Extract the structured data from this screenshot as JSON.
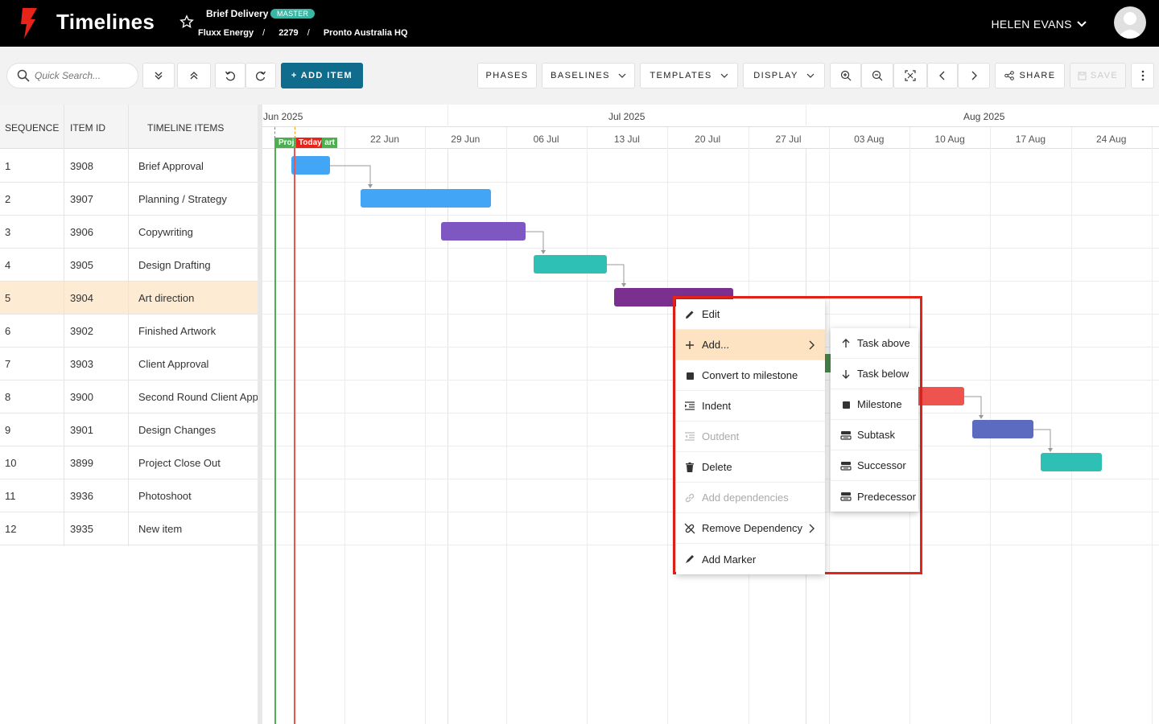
{
  "app": {
    "title": "Timelines"
  },
  "project": {
    "name": "Brief Delivery",
    "badge": "MASTER",
    "client": "Fluxx Energy",
    "job_number": "2279",
    "office": "Pronto Australia HQ"
  },
  "user": {
    "name": "HELEN EVANS"
  },
  "toolbar": {
    "search_placeholder": "Quick Search...",
    "add_item": "+ ADD ITEM",
    "phases": "PHASES",
    "baselines": "BASELINES",
    "templates": "TEMPLATES",
    "display": "DISPLAY",
    "share": "SHARE",
    "save": "SAVE"
  },
  "grid": {
    "headers": {
      "sequence": "SEQUENCE",
      "item_id": "ITEM ID",
      "items": "TIMELINE ITEMS"
    },
    "rows": [
      {
        "seq": "1",
        "id": "3908",
        "name": "Brief Approval"
      },
      {
        "seq": "2",
        "id": "3907",
        "name": "Planning / Strategy"
      },
      {
        "seq": "3",
        "id": "3906",
        "name": "Copywriting"
      },
      {
        "seq": "4",
        "id": "3905",
        "name": "Design Drafting"
      },
      {
        "seq": "5",
        "id": "3904",
        "name": "Art direction"
      },
      {
        "seq": "6",
        "id": "3902",
        "name": "Finished Artwork"
      },
      {
        "seq": "7",
        "id": "3903",
        "name": "Client Approval"
      },
      {
        "seq": "8",
        "id": "3900",
        "name": "Second Round Client Approval"
      },
      {
        "seq": "9",
        "id": "3901",
        "name": "Design Changes"
      },
      {
        "seq": "10",
        "id": "3899",
        "name": "Project Close Out"
      },
      {
        "seq": "11",
        "id": "3936",
        "name": "Photoshoot"
      },
      {
        "seq": "12",
        "id": "3935",
        "name": "New item"
      }
    ]
  },
  "gantt": {
    "months": [
      "Jun 2025",
      "Jul 2025",
      "Aug 2025"
    ],
    "weeks": [
      "22 Jun",
      "29 Jun",
      "06 Jul",
      "13 Jul",
      "20 Jul",
      "27 Jul",
      "03 Aug",
      "10 Aug",
      "17 Aug",
      "24 Aug"
    ],
    "markers": {
      "project_start": "Proj",
      "today": "Today",
      "start": "art"
    },
    "colors": {
      "blue": "#42a5f5",
      "purple": "#7e57c2",
      "teal": "#2ebfb5",
      "dark_purple": "#7b2f8e",
      "green": "#4c8a4a",
      "red": "#ef5350",
      "indigo": "#5c6bc0"
    }
  },
  "context_menu": {
    "items": [
      "Edit",
      "Add...",
      "Convert to milestone",
      "Indent",
      "Outdent",
      "Delete",
      "Add dependencies",
      "Remove Dependency",
      "Add Marker"
    ]
  },
  "submenu": {
    "items": [
      "Task above",
      "Task below",
      "Milestone",
      "Subtask",
      "Successor",
      "Predecessor"
    ]
  }
}
